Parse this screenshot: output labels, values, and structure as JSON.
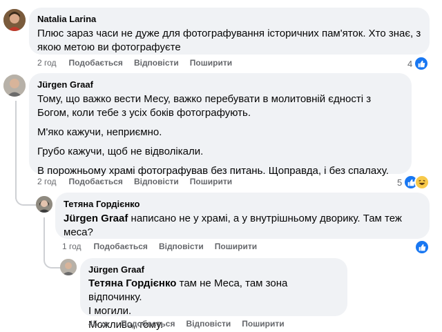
{
  "comments": [
    {
      "author": "Natalia Larina",
      "lines": [
        "Плюс зараз часи не дуже для фотографування історичних пам'яток. Хто знає, з якою метою ви фотографуєте"
      ],
      "time": "2 год",
      "like_label": "Подобається",
      "reply_label": "Відповісти",
      "share_label": "Поширити",
      "reaction_count": "4"
    },
    {
      "author": "Jürgen Graaf",
      "paragraphs": [
        "Тому, що важко вести Месу, важко перебувати в молитовній єдності з Богом, коли тебе з усіх боків фотографують.",
        "М'яко кажучи, неприємно.",
        "Грубо кажучи, щоб не відволікали.",
        "В порожньому храмі фотографував без питань. Щоправда, і без спалаху."
      ],
      "time": "2 год",
      "like_label": "Подобається",
      "reply_label": "Відповісти",
      "share_label": "Поширити",
      "reaction_count": "5"
    },
    {
      "author": "Тетяна Гордієнко",
      "mention": "Jürgen Graaf",
      "text": "написано не у храмі, а у внутрішньому дворику. Там теж меса?",
      "time": "1 год",
      "like_label": "Подобається",
      "reply_label": "Відповісти",
      "share_label": "Поширити"
    },
    {
      "author": "Jürgen Graaf",
      "mention": "Тетяна Гордієнко",
      "text": "там не Меса, там зона відпочинку.",
      "extra_lines": [
        "І могили.",
        "Можливо, тому."
      ],
      "time": "45 хв",
      "like_label": "Подобається",
      "reply_label": "Відповісти",
      "share_label": "Поширити"
    }
  ],
  "colors": {
    "bubble": "#f0f2f5",
    "meta": "#65676b",
    "like_blue": "#1877f2",
    "haha_yellow": "#f7c94a"
  },
  "icons": {
    "like": "like-reaction-icon",
    "haha": "haha-reaction-icon"
  }
}
